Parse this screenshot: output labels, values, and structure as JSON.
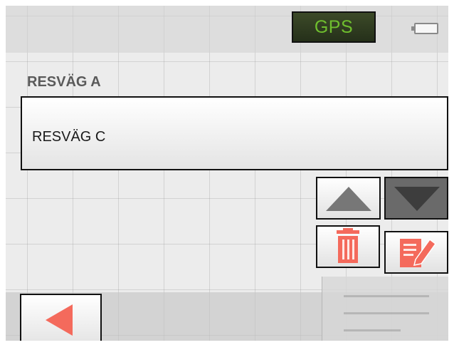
{
  "status_bar": {
    "gps_label": "GPS",
    "gps_text_color": "#6fbf2e",
    "battery_icon": "battery-icon"
  },
  "route_list": {
    "header": "RESVÄG A",
    "items": [
      {
        "label": "RESVÄG C"
      }
    ]
  },
  "actions": {
    "move_up_icon": "triangle-up-icon",
    "move_down_icon": "triangle-down-icon",
    "delete_icon": "trash-icon",
    "edit_icon": "edit-icon",
    "accent_color": "#f46a5c"
  },
  "footer": {
    "back_icon": "back-arrow-icon"
  }
}
